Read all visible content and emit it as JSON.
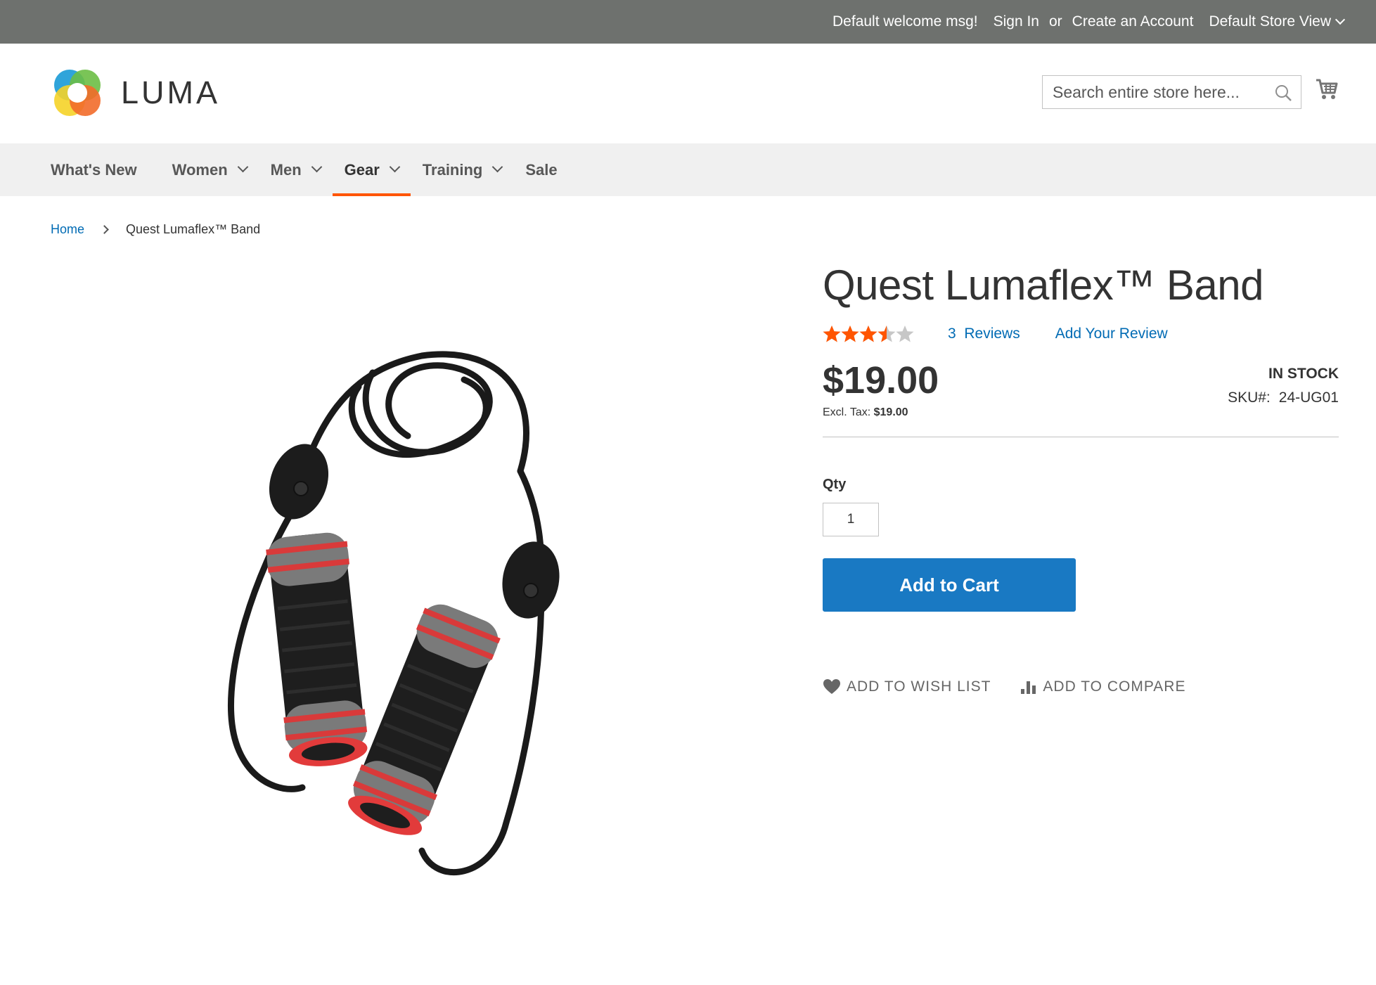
{
  "top_panel": {
    "welcome": "Default welcome msg!",
    "sign_in": "Sign In",
    "or": "or",
    "create_account": "Create an Account",
    "store_view": "Default Store View"
  },
  "header": {
    "logo_text": "LUMA",
    "search_placeholder": "Search entire store here...",
    "icons": [
      "search-icon",
      "cart-icon"
    ]
  },
  "nav": {
    "items": [
      {
        "label": "What's New",
        "dropdown": false
      },
      {
        "label": "Women",
        "dropdown": true
      },
      {
        "label": "Men",
        "dropdown": true
      },
      {
        "label": "Gear",
        "dropdown": true,
        "active": true
      },
      {
        "label": "Training",
        "dropdown": true
      },
      {
        "label": "Sale",
        "dropdown": false
      }
    ],
    "active_color": "#ff5501"
  },
  "breadcrumb": {
    "home": "Home",
    "current": "Quest Lumaflex™ Band"
  },
  "product": {
    "name": "Quest Lumaflex™ Band",
    "rating": 3.5,
    "rating_max": 5,
    "reviews_count": "3",
    "reviews_label": "Reviews",
    "add_review": "Add Your Review",
    "price": "$19.00",
    "excl_tax_label": "Excl. Tax:",
    "excl_tax_value": "$19.00",
    "stock": "IN STOCK",
    "sku_label": "SKU#:",
    "sku": "24-UG01",
    "qty_label": "Qty",
    "qty_value": "1",
    "add_to_cart": "Add to Cart",
    "add_to_wishlist": "ADD TO WISH LIST",
    "add_to_compare": "ADD TO COMPARE"
  },
  "colors": {
    "top_bar": "#6e716e",
    "link": "#006bb4",
    "primary_button": "#1979c3",
    "star": "#ff5501",
    "nav_bg": "#f0f0f0"
  }
}
